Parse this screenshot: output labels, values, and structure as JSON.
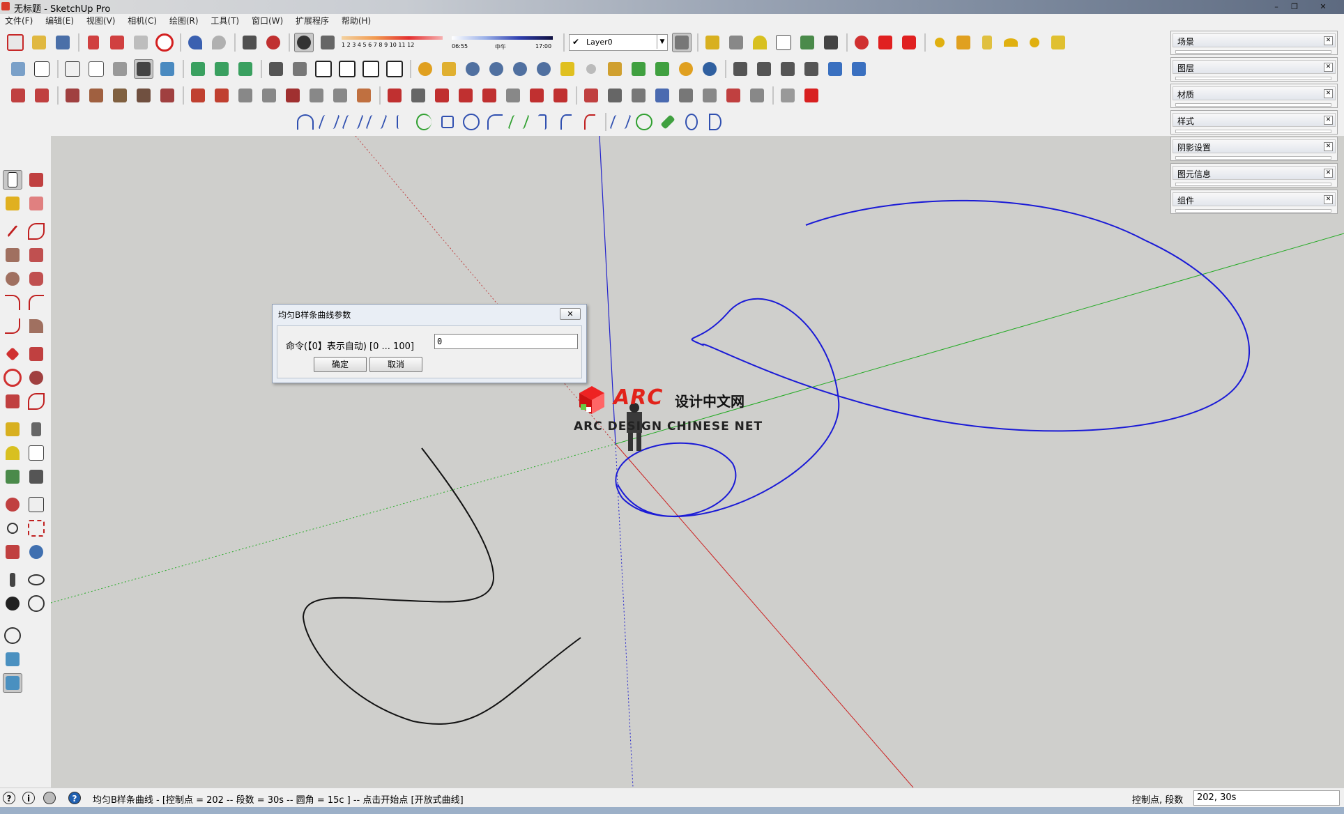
{
  "window": {
    "title": "无标题 - SketchUp Pro",
    "minimize": "–",
    "restore": "❐",
    "close": "✕"
  },
  "menu": [
    "文件(F)",
    "编辑(E)",
    "视图(V)",
    "相机(C)",
    "绘图(R)",
    "工具(T)",
    "窗口(W)",
    "扩展程序",
    "帮助(H)"
  ],
  "toolbar": {
    "layer_value": "Layer0",
    "shadow_months": "1 2 3 4 5 6 7 8 9 10 11 12",
    "shadow_time_start": "06:55",
    "shadow_time_mid": "中午",
    "shadow_time_end": "17:00"
  },
  "panels": [
    {
      "label": "场景"
    },
    {
      "label": "图层"
    },
    {
      "label": "材质"
    },
    {
      "label": "样式"
    },
    {
      "label": "阴影设置"
    },
    {
      "label": "图元信息"
    },
    {
      "label": "组件"
    }
  ],
  "dialog": {
    "title": "均匀B样条曲线参数",
    "close": "✕",
    "prompt": "命令(【0】表示自动) [0 ... 100]",
    "input_value": "0",
    "ok_label": "确定",
    "cancel_label": "取消"
  },
  "watermark": {
    "brand": "ARC",
    "cn": "设计中文网",
    "en": "ARC DESIGN CHINESE NET"
  },
  "status": {
    "message": "均匀B样条曲线 - [控制点 = 202  -- 段数 = 30s  -- 圆角 = 15c ]   -- 点击开始点  [开放式曲线]",
    "value_label": "控制点, 段数",
    "value": "202, 30s"
  },
  "colors": {
    "viewport_bg": "#cfcfcc",
    "curve_blue": "#1a1ad6",
    "axis_red": "#cc2222",
    "axis_green": "#22aa22",
    "axis_blue": "#2222cc"
  }
}
